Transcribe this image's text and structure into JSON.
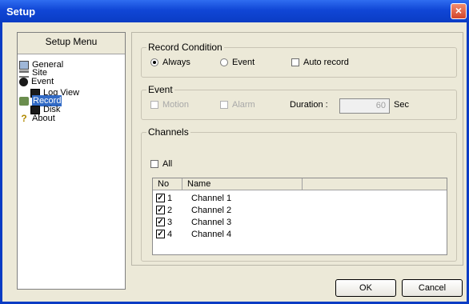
{
  "window": {
    "title": "Setup",
    "close_glyph": "×"
  },
  "menu": {
    "header": "Setup Menu",
    "items": [
      {
        "label": "General",
        "icon": "monitor-icon"
      },
      {
        "label": "Site",
        "icon": "network-icon"
      },
      {
        "label": "Event",
        "icon": "bomb-icon"
      },
      {
        "label": "Log View",
        "icon": "floppy-icon"
      },
      {
        "label": "Record",
        "icon": "camera-icon",
        "selected": true
      },
      {
        "label": "Disk",
        "icon": "floppy-icon"
      },
      {
        "label": "About",
        "icon": "question-icon"
      }
    ]
  },
  "record_condition": {
    "title": "Record Condition",
    "always_label": "Always",
    "event_label": "Event",
    "auto_label": "Auto record",
    "selected": "Always",
    "auto_checked": false
  },
  "event": {
    "title": "Event",
    "motion_label": "Motion",
    "alarm_label": "Alarm",
    "duration_label": "Duration :",
    "duration_value": "60",
    "unit": "Sec"
  },
  "channels": {
    "title": "Channels",
    "all_label": "All",
    "all_checked": false,
    "columns": [
      "No",
      "Name"
    ],
    "rows": [
      {
        "no": "1",
        "name": "Channel 1",
        "checked": true
      },
      {
        "no": "2",
        "name": "Channel 2",
        "checked": true
      },
      {
        "no": "3",
        "name": "Channel 3",
        "checked": true
      },
      {
        "no": "4",
        "name": "Channel 4",
        "checked": true
      }
    ]
  },
  "buttons": {
    "ok": "OK",
    "cancel": "Cancel"
  }
}
